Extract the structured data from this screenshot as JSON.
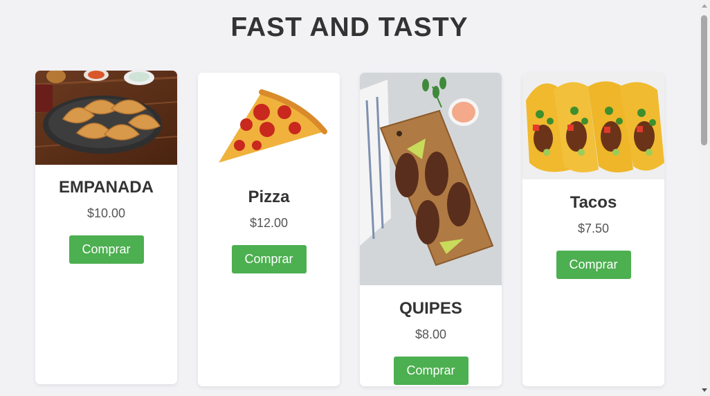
{
  "page": {
    "title": "FAST AND TASTY"
  },
  "products": [
    {
      "name": "EMPANADA",
      "price": "$10.00",
      "button": "Comprar",
      "image": "empanadas-photo"
    },
    {
      "name": "Pizza",
      "price": "$12.00",
      "button": "Comprar",
      "image": "pizza-slice-photo"
    },
    {
      "name": "QUIPES",
      "price": "$8.00",
      "button": "Comprar",
      "image": "quipes-photo"
    },
    {
      "name": "Tacos",
      "price": "$7.50",
      "button": "Comprar",
      "image": "tacos-photo"
    }
  ],
  "colors": {
    "background": "#f2f2f5",
    "accent": "#4caf50",
    "title": "#333333"
  }
}
